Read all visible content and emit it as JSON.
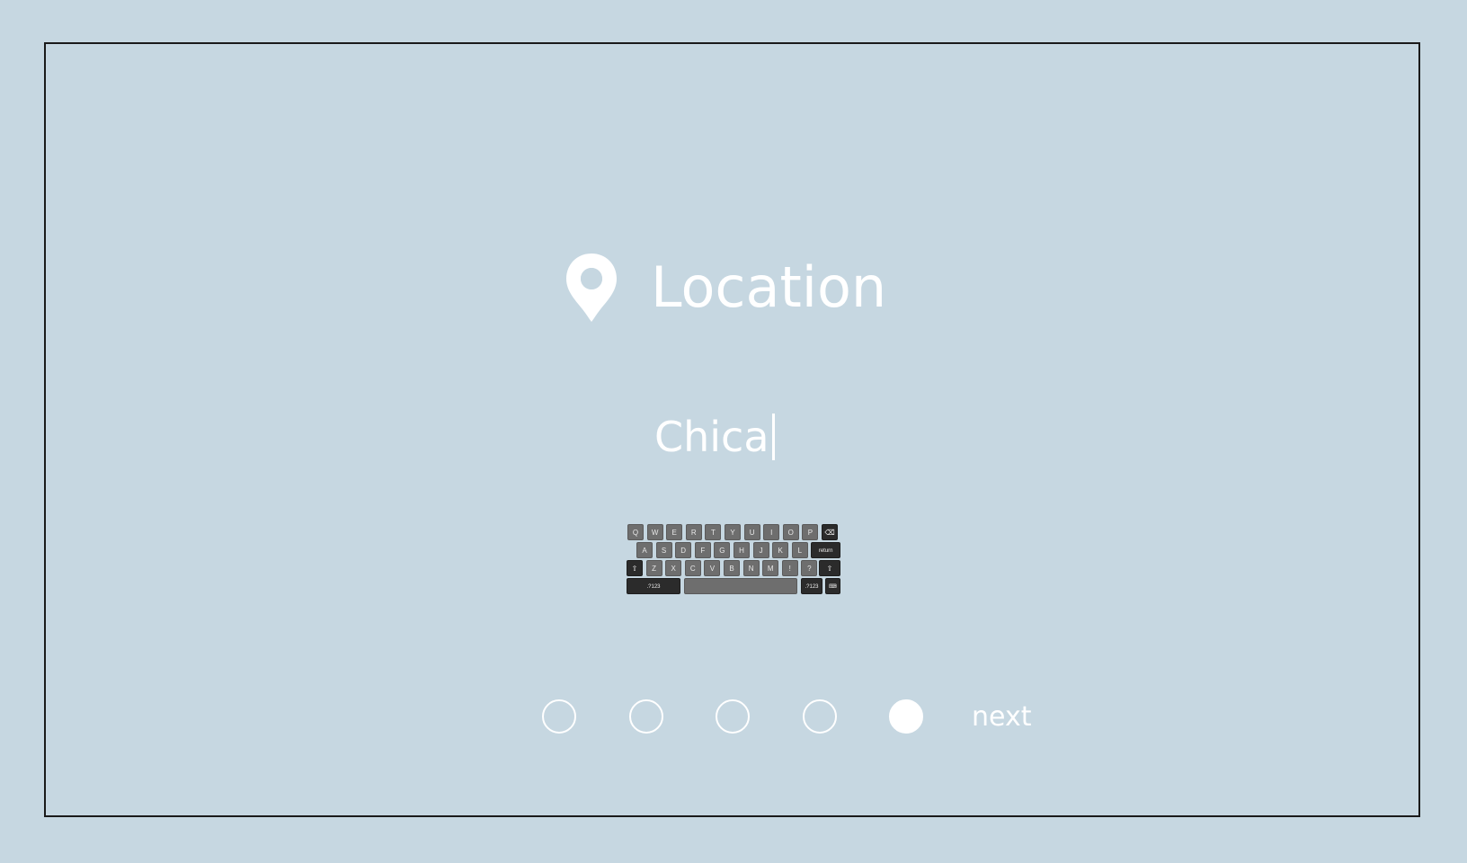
{
  "header": {
    "icon": "map-pin-icon",
    "title": "Location"
  },
  "input": {
    "value": "Chica"
  },
  "keyboard": {
    "rows": [
      [
        "Q",
        "W",
        "E",
        "R",
        "T",
        "Y",
        "U",
        "I",
        "O",
        "P",
        "⌫"
      ],
      [
        "A",
        "S",
        "D",
        "F",
        "G",
        "H",
        "J",
        "K",
        "L",
        "return"
      ],
      [
        "⇧",
        "Z",
        "X",
        "C",
        "V",
        "B",
        "N",
        "M",
        "!",
        "?",
        "⇧"
      ],
      [
        ".?123",
        "",
        ".?123",
        "⌨"
      ]
    ]
  },
  "pager": {
    "total": 5,
    "active_index": 4
  },
  "next_label": "next",
  "colors": {
    "background": "#c6d7e1",
    "foreground": "#ffffff",
    "key": "#6e6e6e",
    "key_dark": "#2b2b2b"
  }
}
